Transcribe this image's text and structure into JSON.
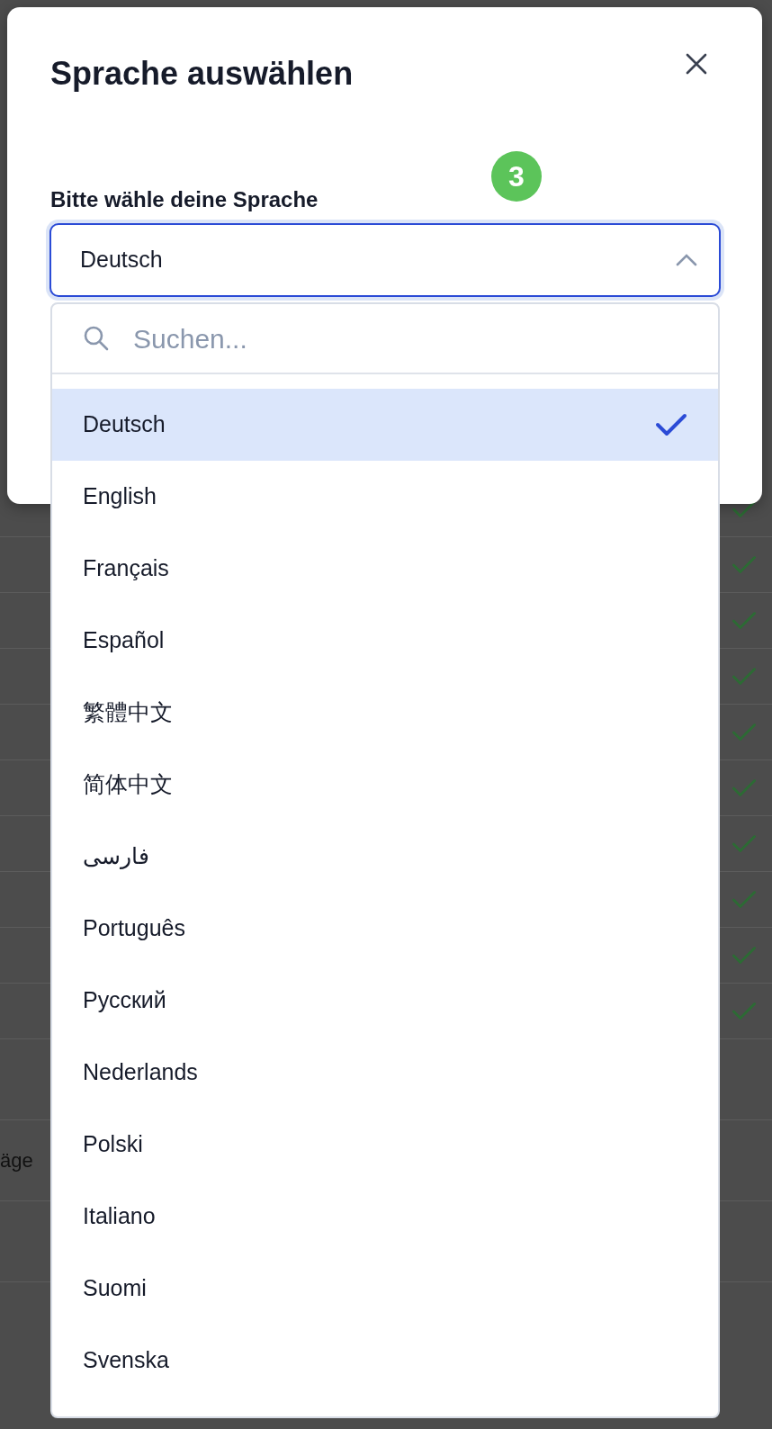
{
  "background": {
    "rows": [
      {
        "checked": true
      },
      {
        "checked": true
      },
      {
        "checked": true
      },
      {
        "checked": true
      },
      {
        "checked": true
      },
      {
        "checked": true
      },
      {
        "checked": true
      },
      {
        "checked": true
      },
      {
        "checked": true
      },
      {
        "checked": true
      },
      {
        "checked": false
      },
      {
        "checked": false
      },
      {
        "checked": false
      }
    ],
    "fragment_text": "äge"
  },
  "dialog": {
    "title": "Sprache auswählen",
    "step_badge": "3",
    "field_label": "Bitte wähle deine Sprache",
    "select": {
      "value": "Deutsch",
      "expanded": true
    },
    "dropdown": {
      "search": {
        "placeholder": "Suchen..."
      },
      "options": [
        {
          "label": "Deutsch",
          "selected": true
        },
        {
          "label": "English",
          "selected": false
        },
        {
          "label": "Français",
          "selected": false
        },
        {
          "label": "Español",
          "selected": false
        },
        {
          "label": "繁體中文",
          "selected": false
        },
        {
          "label": "简体中文",
          "selected": false
        },
        {
          "label": "فارسی",
          "selected": false
        },
        {
          "label": "Português",
          "selected": false
        },
        {
          "label": "Русский",
          "selected": false
        },
        {
          "label": "Nederlands",
          "selected": false
        },
        {
          "label": "Polski",
          "selected": false
        },
        {
          "label": "Italiano",
          "selected": false
        },
        {
          "label": "Suomi",
          "selected": false
        },
        {
          "label": "Svenska",
          "selected": false
        }
      ]
    }
  }
}
